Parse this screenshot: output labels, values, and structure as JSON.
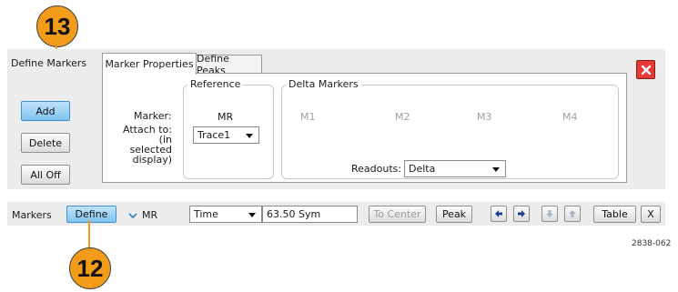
{
  "callouts": {
    "top": "13",
    "bottom": "12"
  },
  "define_markers_label": "Define Markers",
  "tabs": {
    "marker_properties": "Marker Properties",
    "define_peaks": "Define Peaks"
  },
  "buttons": {
    "add": "Add",
    "delete": "Delete",
    "all_off": "All Off"
  },
  "reference": {
    "legend": "Reference",
    "marker_label": "Marker:",
    "marker_value": "MR",
    "attach_label": "Attach to:\n(in selected\ndisplay)",
    "attach_value": "Trace1"
  },
  "delta": {
    "legend": "Delta Markers",
    "markers": [
      "M1",
      "M2",
      "M3",
      "M4"
    ],
    "readouts_label": "Readouts:",
    "readouts_value": "Delta"
  },
  "bottom_bar": {
    "markers_label": "Markers",
    "define_button": "Define",
    "marker_select": "MR",
    "time_select": "Time",
    "value_field": "63.50 Sym",
    "to_center": "To Center",
    "peak": "Peak",
    "table": "Table",
    "x": "X"
  },
  "figure_id": "2838-062",
  "colors": {
    "callout": "#f39c1a",
    "close": "#e53935",
    "blue_button": "#80c4ef"
  },
  "icons": [
    "close-icon",
    "arrow-left-icon",
    "arrow-right-icon",
    "arrow-down-icon",
    "arrow-up-icon",
    "chevron-down-icon"
  ]
}
